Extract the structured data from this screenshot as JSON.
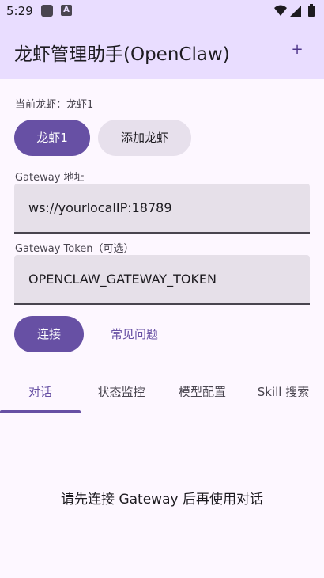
{
  "status_bar": {
    "time": "5:29",
    "notification_icons": [
      "square-notification-icon",
      "a-notification-icon"
    ],
    "system_icons": [
      "wifi-icon",
      "signal-icon",
      "battery-icon"
    ],
    "notification_a_glyph": "A"
  },
  "app_bar": {
    "title": "龙虾管理助手(OpenClaw)",
    "add_label": "+"
  },
  "current": {
    "label": "当前龙虾：龙虾1"
  },
  "chips": [
    {
      "label": "龙虾1",
      "selected": true
    },
    {
      "label": "添加龙虾",
      "selected": false
    }
  ],
  "gateway": {
    "label": "Gateway 地址",
    "value": "ws://yourlocalIP:18789"
  },
  "token": {
    "label": "Gateway Token（可选）",
    "value": "OPENCLAW_GATEWAY_TOKEN"
  },
  "actions": {
    "connect": "连接",
    "faq": "常见问题"
  },
  "tabs": [
    {
      "label": "对话",
      "active": true
    },
    {
      "label": "状态监控",
      "active": false
    },
    {
      "label": "模型配置",
      "active": false
    },
    {
      "label": "Skill 搜索",
      "active": false
    }
  ],
  "chat": {
    "empty_message": "请先连接 Gateway 后再使用对话"
  },
  "colors": {
    "primary": "#6750a4",
    "app_bar": "#e9ddff",
    "background": "#fdf7ff",
    "field": "#e6e0e9",
    "chip_unselected": "#e7e0ec"
  }
}
